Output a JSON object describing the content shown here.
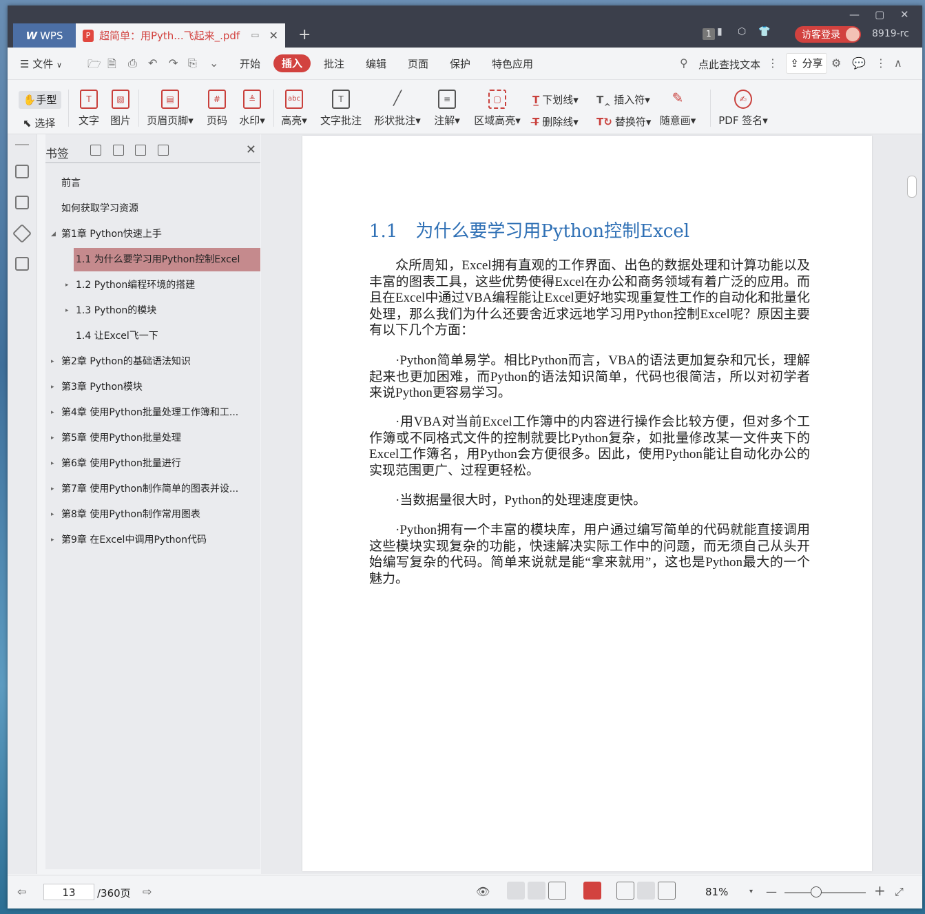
{
  "titlebar": {
    "app_tab": "WPS",
    "doc_tab": "超简单：用Pyth...飞起来_.pdf",
    "badge": "1",
    "login": "访客登录",
    "user": "8919-rc"
  },
  "menu": {
    "file": "文件",
    "items": [
      "开始",
      "插入",
      "批注",
      "编辑",
      "页面",
      "保护",
      "特色应用"
    ],
    "active": "插入",
    "search": "点此查找文本",
    "share": "分享"
  },
  "ribbon": {
    "hand": "手型",
    "select": "选择",
    "text": "文字",
    "image": "图片",
    "header_footer": "页眉页脚",
    "page_num": "页码",
    "watermark": "水印",
    "highlight": "高亮",
    "text_comment": "文字批注",
    "shape_comment": "形状批注",
    "annotation": "注解",
    "area_highlight": "区域高亮",
    "underline": "下划线",
    "strikethrough": "删除线",
    "insert_mark": "插入符",
    "replace_mark": "替换符",
    "freehand": "随意画",
    "pdf_sign": "PDF 签名",
    "abc": "abc"
  },
  "panel": {
    "title": "书签",
    "bookmarks": [
      {
        "label": "前言"
      },
      {
        "label": "如何获取学习资源"
      },
      {
        "label": "第1章 Python快速上手"
      },
      {
        "label": "1.1 为什么要学习用Python控制Excel"
      },
      {
        "label": "1.2 Python编程环境的搭建"
      },
      {
        "label": "1.3 Python的模块"
      },
      {
        "label": "1.4 让Excel飞一下"
      },
      {
        "label": "第2章 Python的基础语法知识"
      },
      {
        "label": "第3章 Python模块"
      },
      {
        "label": "第4章 使用Python批量处理工作簿和工..."
      },
      {
        "label": "第5章 使用Python批量处理"
      },
      {
        "label": "第6章 使用Python批量进行"
      },
      {
        "label": "第7章 使用Python制作简单的图表并设..."
      },
      {
        "label": "第8章 使用Python制作常用图表"
      },
      {
        "label": "第9章 在Excel中调用Python代码"
      }
    ]
  },
  "document": {
    "heading_num": "1.1",
    "heading": "为什么要学习用Python控制Excel",
    "paragraphs": [
      "众所周知，Excel拥有直观的工作界面、出色的数据处理和计算功能以及丰富的图表工具，这些优势使得Excel在办公和商务领域有着广泛的应用。而且在Excel中通过VBA编程能让Excel更好地实现重复性工作的自动化和批量化处理，那么我们为什么还要舍近求远地学习用Python控制Excel呢？原因主要有以下几个方面：",
      "·Python简单易学。相比Python而言，VBA的语法更加复杂和冗长，理解起来也更加困难，而Python的语法知识简单，代码也很简洁，所以对初学者来说Python更容易学习。",
      "·用VBA对当前Excel工作簿中的内容进行操作会比较方便，但对多个工作簿或不同格式文件的控制就要比Python复杂，如批量修改某一文件夹下的Excel工作簿名，用Python会方便很多。因此，使用Python能让自动化办公的实现范围更广、过程更轻松。",
      "·当数据量很大时，Python的处理速度更快。",
      "·Python拥有一个丰富的模块库，用户通过编写简单的代码就能直接调用这些模块实现复杂的功能，快速解决实际工作中的问题，而无须自己从头开始编写复杂的代码。简单来说就是能“拿来就用”，这也是Python最大的一个魅力。"
    ]
  },
  "status": {
    "page": "13",
    "total": "/360页",
    "zoom": "81%"
  },
  "colors": {
    "accent": "#d2423f",
    "heading": "#2f70b5",
    "selected_bookmark": "#c58a8d"
  }
}
